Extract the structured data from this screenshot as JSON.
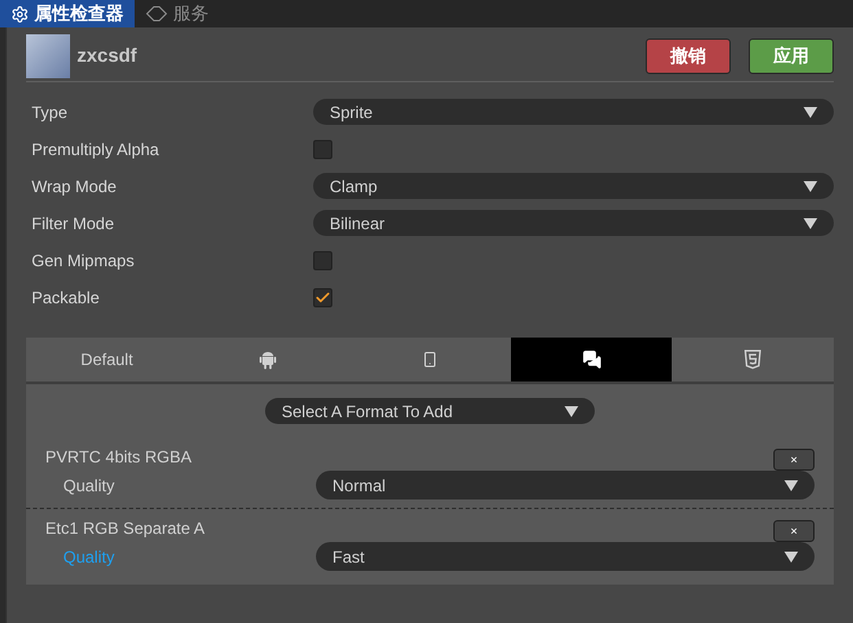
{
  "panel_tabs": [
    {
      "label": "属性检查器",
      "selected": true
    },
    {
      "label": "服务",
      "selected": false
    }
  ],
  "asset": {
    "name": "zxcsdf"
  },
  "buttons": {
    "revert": "撤销",
    "apply": "应用"
  },
  "properties": [
    {
      "kind": "select",
      "label": "Type",
      "value": "Sprite"
    },
    {
      "kind": "checkbox",
      "label": "Premultiply Alpha",
      "checked": false
    },
    {
      "kind": "select",
      "label": "Wrap Mode",
      "value": "Clamp"
    },
    {
      "kind": "select",
      "label": "Filter Mode",
      "value": "Bilinear"
    },
    {
      "kind": "checkbox",
      "label": "Gen Mipmaps",
      "checked": false
    },
    {
      "kind": "checkbox",
      "label": "Packable",
      "checked": true
    }
  ],
  "platform_tabs": [
    {
      "label": "Default",
      "selected": false
    },
    {
      "selected": false
    },
    {
      "selected": false
    },
    {
      "selected": true
    },
    {
      "selected": false
    }
  ],
  "format_select": {
    "placeholder": "Select A Format To Add"
  },
  "formats": [
    {
      "name": "PVRTC 4bits RGBA",
      "remove": "×",
      "quality_label": "Quality",
      "quality_highlighted": false,
      "quality": "Normal"
    },
    {
      "name": "Etc1 RGB Separate A",
      "remove": "×",
      "quality_label": "Quality",
      "quality_highlighted": true,
      "quality": "Fast"
    }
  ]
}
